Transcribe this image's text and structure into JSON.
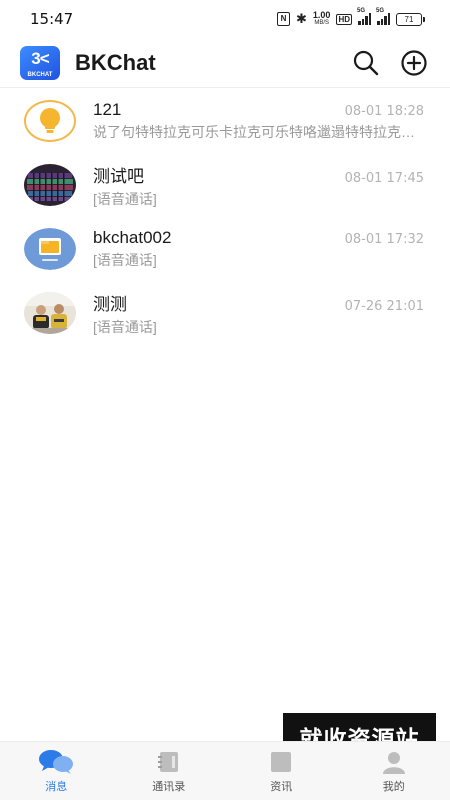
{
  "status_bar": {
    "time": "15:47",
    "nfc": "N",
    "speed_value": "1.00",
    "speed_unit": "MB/S",
    "hd": "HD",
    "signal1_label": "5G",
    "signal2_label": "5G",
    "battery": "71"
  },
  "header": {
    "logo_mark": "3<",
    "logo_word": "BKCHAT",
    "title": "BKChat",
    "icons": [
      "search-icon",
      "add-circle-icon"
    ]
  },
  "chats": [
    {
      "name": "121",
      "time": "08-01 18:28",
      "preview": "说了句特特拉克可乐卡拉克可乐特咯邋遢特特拉克可乐",
      "avatar": "lightbulb-avatar"
    },
    {
      "name": "测试吧",
      "time": "08-01 17:45",
      "preview": "[语音通话]",
      "avatar": "keyboard-photo-avatar"
    },
    {
      "name": "bkchat002",
      "time": "08-01 17:32",
      "preview": "[语音通话]",
      "avatar": "folder-avatar"
    },
    {
      "name": "测测",
      "time": "07-26 21:01",
      "preview": "[语音通话]",
      "avatar": "people-photo-avatar"
    }
  ],
  "nav": [
    {
      "label": "消息",
      "icon": "chat-bubbles-icon",
      "active": true
    },
    {
      "label": "通讯录",
      "icon": "address-book-icon",
      "active": false
    },
    {
      "label": "资讯",
      "icon": "news-icon",
      "active": false
    },
    {
      "label": "我的",
      "icon": "profile-icon",
      "active": false
    }
  ],
  "watermark": "就收资源站",
  "colors": {
    "accent": "#2d7be8",
    "logo_blue": "#2a6cf0",
    "time_gray": "#b3b3b3",
    "preview_gray": "#9a9a9a"
  }
}
